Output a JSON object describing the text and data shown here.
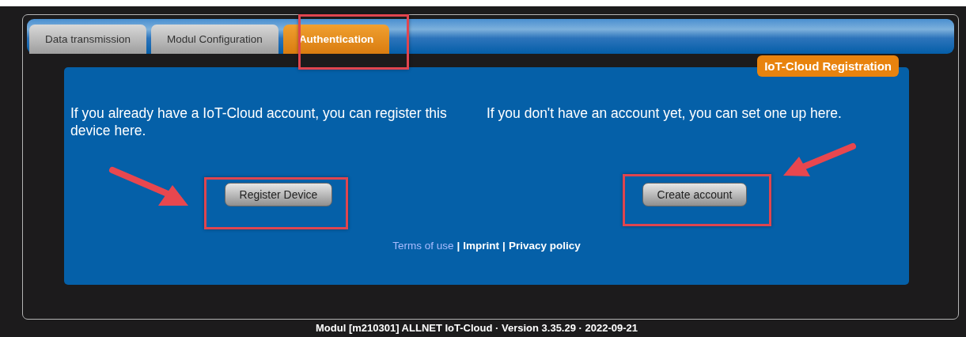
{
  "tabs": [
    {
      "label": "Data transmission",
      "selected": false
    },
    {
      "label": "Modul Configuration",
      "selected": false
    },
    {
      "label": "Authentication",
      "selected": true
    }
  ],
  "panel": {
    "badge": "IoT-Cloud Registration",
    "columns": [
      {
        "text": "If you already have a IoT-Cloud account, you can register this device here.",
        "button": "Register Device"
      },
      {
        "text": "If you don't have an account yet, you can set one up here.",
        "button": "Create account"
      }
    ],
    "links": [
      {
        "label": "Terms of use",
        "kind": "link"
      },
      {
        "label": "Imprint",
        "kind": "plain"
      },
      {
        "label": "Privacy policy",
        "kind": "plain"
      }
    ],
    "separator": "|"
  },
  "footer": "Modul [m210301] ALLNET IoT-Cloud · Version 3.35.29 · 2022-09-21"
}
